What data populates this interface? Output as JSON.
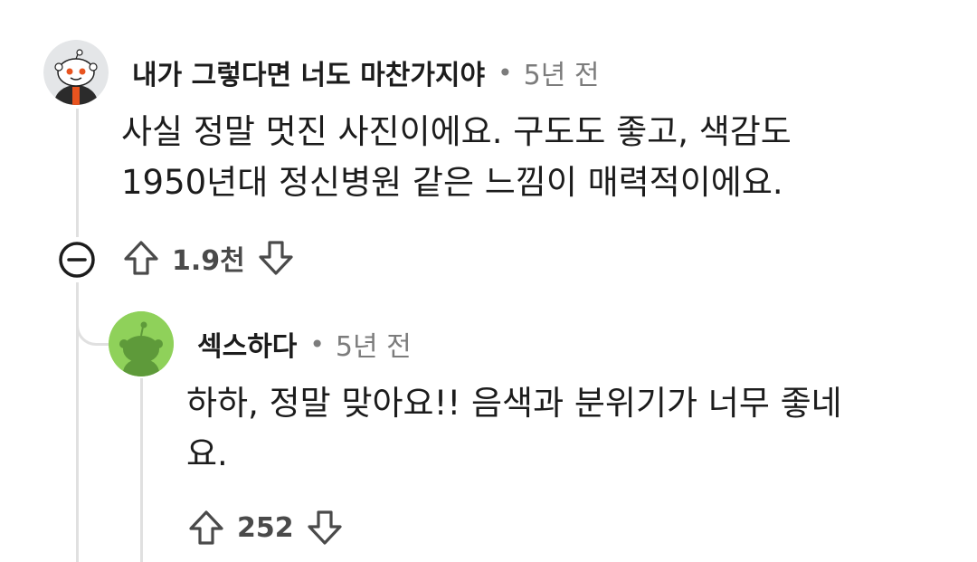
{
  "comment": {
    "author": "내가 그렇다면 너도 마찬가지야",
    "separator": "•",
    "time": "5년 전",
    "text_line1": "사실 정말 멋진 사진이에요. 구도도 좋고, 색감도",
    "text_line2": "1950년대 정신병원 같은 느낌이 매력적이에요.",
    "votes": "1.9천"
  },
  "reply": {
    "author": "섹스하다",
    "separator": "•",
    "time": "5년 전",
    "text_line1": "하하, 정말 맞아요!! 음색과 분위기가 너무 좋네",
    "text_line2": "요.",
    "votes": "252"
  },
  "colors": {
    "thread_line": "#e0e0e0",
    "reply_avatar_bg": "#8fd15a",
    "icon_stroke": "#4a4a4a"
  },
  "icons": {
    "upvote": "arrow-up-outline-icon",
    "downvote": "arrow-down-outline-icon",
    "collapse": "minus-circle-icon"
  }
}
